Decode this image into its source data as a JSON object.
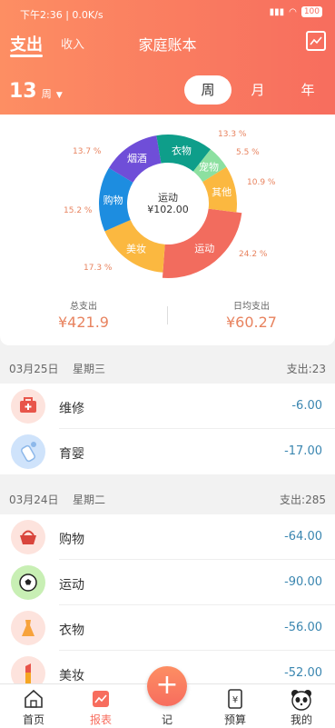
{
  "status_bar": {
    "time": "下午2:36 | 0.0K/s",
    "battery": "100"
  },
  "header": {
    "tab_expense": "支出",
    "tab_income": "收入",
    "title": "家庭账本"
  },
  "period": {
    "number": "13",
    "unit": "周",
    "segments": [
      "周",
      "月",
      "年"
    ],
    "active": "周"
  },
  "chart_data": {
    "type": "pie",
    "center_label": "运动",
    "center_value": "¥102.00",
    "slices": [
      {
        "name": "运动",
        "percent": 24.2,
        "color": "#f26c5e"
      },
      {
        "name": "美妆",
        "percent": 17.3,
        "color": "#fbb840"
      },
      {
        "name": "购物",
        "percent": 15.2,
        "color": "#1d8de0"
      },
      {
        "name": "烟酒",
        "percent": 13.7,
        "color": "#6f4ed8"
      },
      {
        "name": "衣物",
        "percent": 13.3,
        "color": "#0e9e8a"
      },
      {
        "name": "宠物",
        "percent": 5.5,
        "color": "#8ce0a0"
      },
      {
        "name": "其他",
        "percent": 10.9,
        "color": "#fbb840"
      }
    ],
    "pct_labels": [
      "24.2 %",
      "17.3 %",
      "15.2 %",
      "13.7 %",
      "13.3 %",
      "5.5 %",
      "10.9 %"
    ]
  },
  "summary": {
    "total_label": "总支出",
    "total_value": "¥421.9",
    "avg_label": "日均支出",
    "avg_value": "¥60.27"
  },
  "days": [
    {
      "date": "03月25日",
      "weekday": "星期三",
      "sum": "支出:23",
      "items": [
        {
          "name": "维修",
          "amount": "-6.00",
          "icon": "toolbox-icon"
        },
        {
          "name": "育婴",
          "amount": "-17.00",
          "icon": "baby-bottle-icon"
        }
      ]
    },
    {
      "date": "03月24日",
      "weekday": "星期二",
      "sum": "支出:285",
      "items": [
        {
          "name": "购物",
          "amount": "-64.00",
          "icon": "basket-icon"
        },
        {
          "name": "运动",
          "amount": "-90.00",
          "icon": "soccer-ball-icon"
        },
        {
          "name": "衣物",
          "amount": "-56.00",
          "icon": "dress-icon"
        },
        {
          "name": "美妆",
          "amount": "-52.00",
          "icon": "lipstick-icon"
        }
      ]
    }
  ],
  "nav": {
    "home": "首页",
    "report": "报表",
    "add": "记",
    "budget": "预算",
    "mine": "我的"
  }
}
